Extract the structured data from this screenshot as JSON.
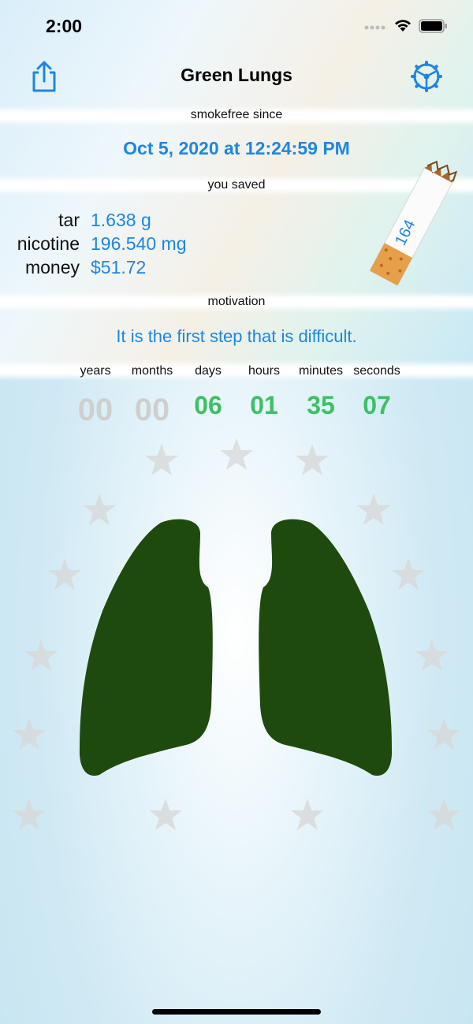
{
  "status_bar": {
    "time": "2:00"
  },
  "nav": {
    "title": "Green Lungs",
    "share_icon": "share-icon",
    "settings_icon": "gear-wheel-icon"
  },
  "smokefree": {
    "label": "smokefree since",
    "date": "Oct 5, 2020 at 12:24:59 PM"
  },
  "saved": {
    "label": "you saved",
    "items": [
      {
        "key": "tar",
        "value": "1.638 g"
      },
      {
        "key": "nicotine",
        "value": "196.540 mg"
      },
      {
        "key": "money",
        "value": "$51.72"
      }
    ],
    "cigarettes": "164"
  },
  "motivation": {
    "label": "motivation",
    "text": "It is the first step that is difficult."
  },
  "counter": {
    "units": [
      {
        "label": "years",
        "value": "00"
      },
      {
        "label": "months",
        "value": "00"
      },
      {
        "label": "days",
        "value": "06"
      },
      {
        "label": "hours",
        "value": "01"
      },
      {
        "label": "minutes",
        "value": "35"
      },
      {
        "label": "seconds",
        "value": "07"
      }
    ]
  },
  "colors": {
    "accent_blue": "#1e86e0",
    "counter_green": "#3cc064",
    "lung_green": "#1f4a0e"
  }
}
